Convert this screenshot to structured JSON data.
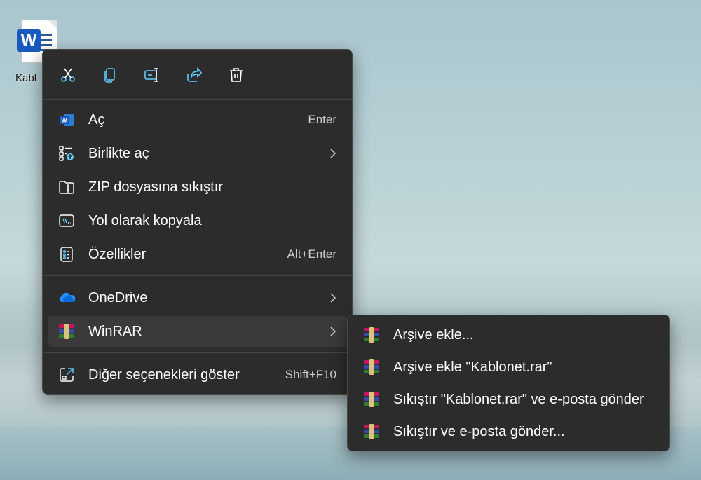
{
  "desktop": {
    "icon_label": "Kabl"
  },
  "context_menu": {
    "toolbar": [
      {
        "name": "cut",
        "icon": "scissors-icon"
      },
      {
        "name": "copy",
        "icon": "copy-icon"
      },
      {
        "name": "rename",
        "icon": "rename-icon"
      },
      {
        "name": "share",
        "icon": "share-icon"
      },
      {
        "name": "delete",
        "icon": "trash-icon"
      }
    ],
    "items": [
      {
        "label": "Aç",
        "shortcut": "Enter",
        "icon": "word-icon"
      },
      {
        "label": "Birlikte aç",
        "shortcut": "",
        "icon": "open-with-icon",
        "submenu": true
      },
      {
        "label": "ZIP dosyasına sıkıştır",
        "shortcut": "",
        "icon": "zip-folder-icon"
      },
      {
        "label": "Yol olarak kopyala",
        "shortcut": "",
        "icon": "copy-path-icon"
      },
      {
        "label": "Özellikler",
        "shortcut": "Alt+Enter",
        "icon": "properties-icon"
      },
      {
        "label": "OneDrive",
        "shortcut": "",
        "icon": "onedrive-icon",
        "submenu": true
      },
      {
        "label": "WinRAR",
        "shortcut": "",
        "icon": "winrar-icon",
        "submenu": true
      },
      {
        "label": "Diğer seçenekleri göster",
        "shortcut": "Shift+F10",
        "icon": "more-options-icon"
      }
    ]
  },
  "winrar_submenu": {
    "items": [
      {
        "label": "Arşive ekle..."
      },
      {
        "label": "Arşive ekle \"Kablonet.rar\""
      },
      {
        "label": "Sıkıştır \"Kablonet.rar\" ve e-posta gönder"
      },
      {
        "label": "Sıkıştır ve e-posta gönder..."
      }
    ]
  },
  "colors": {
    "menu_bg": "#2c2c2c",
    "hover_bg": "#3a3a3a",
    "accent": "#60cdff",
    "text": "#ffffff"
  }
}
